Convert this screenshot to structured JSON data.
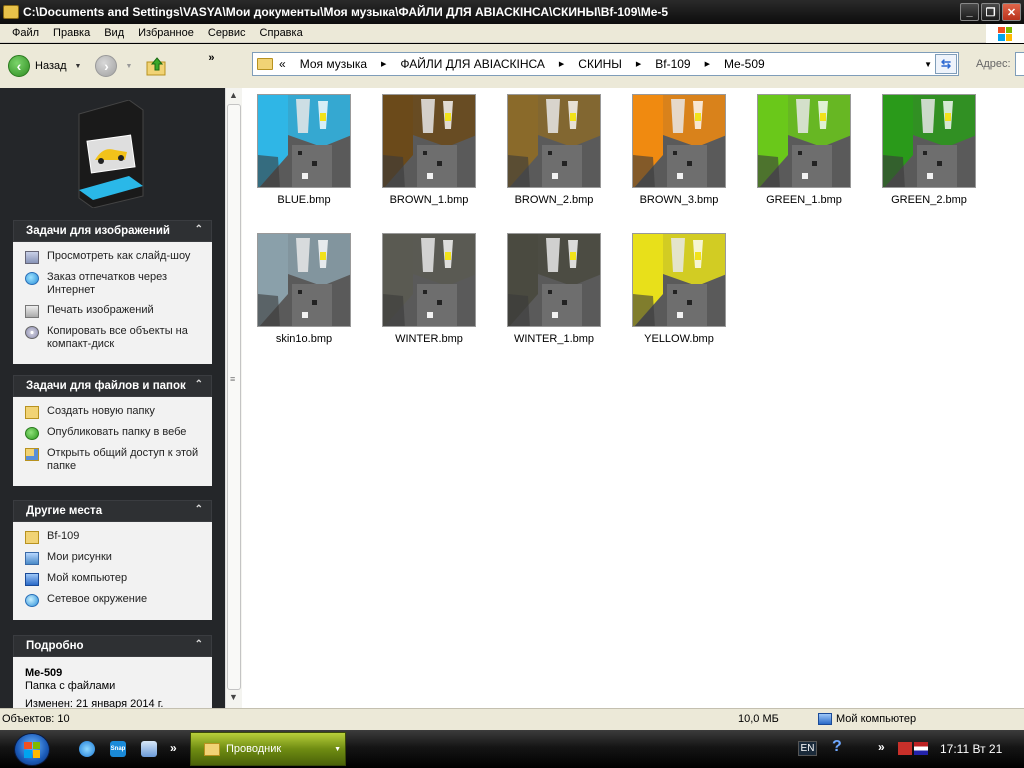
{
  "window": {
    "title": "C:\\Documents and Settings\\VASYA\\Мои документы\\Моя музыка\\ФАЙЛИ ДЛЯ АВІАСКІНСА\\СКИНЫ\\Bf-109\\Me-5"
  },
  "menu": [
    "Файл",
    "Правка",
    "Вид",
    "Избранное",
    "Сервис",
    "Справка"
  ],
  "toolbar": {
    "back_label": "Назад",
    "more": "»"
  },
  "address": {
    "overflow": "«",
    "crumbs": [
      "Моя музыка",
      "ФАЙЛИ ДЛЯ АВІАСКІНСА",
      "СКИНЫ",
      "Bf-109",
      "Me-509"
    ],
    "label": "Адрес:"
  },
  "sidebar": {
    "image_tasks": {
      "title": "Задачи для изображений",
      "items": [
        "Просмотреть как слайд-шоу",
        "Заказ отпечатков через Интернет",
        "Печать изображений",
        "Копировать все объекты на компакт-диск"
      ]
    },
    "file_tasks": {
      "title": "Задачи для файлов и папок",
      "items": [
        "Создать новую папку",
        "Опубликовать папку в вебе",
        "Открыть общий доступ к этой папке"
      ]
    },
    "other_places": {
      "title": "Другие места",
      "items": [
        "Bf-109",
        "Мои рисунки",
        "Мой компьютер",
        "Сетевое окружение"
      ]
    },
    "details": {
      "title": "Подробно",
      "name": "Me-509",
      "type": "Папка с файлами",
      "modified": "Изменен: 21 января 2014 г."
    }
  },
  "files": [
    {
      "name": "BLUE.bmp",
      "color": "#2fb6e6"
    },
    {
      "name": "BROWN_1.bmp",
      "color": "#6b4a1a"
    },
    {
      "name": "BROWN_2.bmp",
      "color": "#8a6a2a"
    },
    {
      "name": "BROWN_3.bmp",
      "color": "#f08a10"
    },
    {
      "name": "GREEN_1.bmp",
      "color": "#6ac81a"
    },
    {
      "name": "GREEN_2.bmp",
      "color": "#2a9a1a"
    },
    {
      "name": "skin1o.bmp",
      "color": "#8aa0aa"
    },
    {
      "name": "WINTER.bmp",
      "color": "#5a5a52"
    },
    {
      "name": "WINTER_1.bmp",
      "color": "#4a4a40"
    },
    {
      "name": "YELLOW.bmp",
      "color": "#e8e01a"
    }
  ],
  "status": {
    "objects": "Объектов: 10",
    "size": "10,0 МБ",
    "location": "Мой компьютер"
  },
  "taskbar": {
    "snap_text": "Snap",
    "more": "»",
    "task_label": "Проводник",
    "lang": "EN",
    "help": "?",
    "tray_more": "»",
    "clock": "17:11 Вт 21"
  }
}
